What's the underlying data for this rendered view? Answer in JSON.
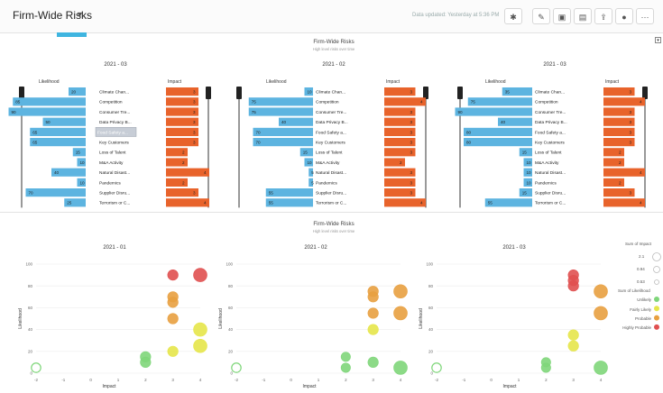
{
  "header": {
    "title": "Firm-Wide Risks",
    "updated": "Data updated: Yesterday at 5:36 PM"
  },
  "top_section": {
    "title": "Firm-Wide Risks",
    "subtitle": "High level risks over time",
    "likelihood_label": "Likelihood",
    "impact_label": "Impact",
    "panels": [
      {
        "period": "2021 - 03"
      },
      {
        "period": "2021 - 02"
      },
      {
        "period": "2021 - 03"
      }
    ],
    "tooltip": "Food Safety a..."
  },
  "bottom_section": {
    "title": "Firm-Wide Risks",
    "subtitle": "High level risks over time",
    "panels": [
      {
        "period": "2021 - 01"
      },
      {
        "period": "2021 - 02"
      },
      {
        "period": "2021 - 03"
      }
    ],
    "x_label": "Impact",
    "y_label": "Likelihood"
  },
  "legend": {
    "size_title": "Sum of Impact",
    "size_items": [
      "2.1",
      "0.94",
      "0.53"
    ],
    "color_title": "Sum of Likelihood",
    "color_items": [
      {
        "label": "Unlikely",
        "color": "#7fd67a"
      },
      {
        "label": "Fairly Likely",
        "color": "#e6e64a"
      },
      {
        "label": "Probable",
        "color": "#e8a040"
      },
      {
        "label": "Highly Probable",
        "color": "#e05050"
      }
    ]
  },
  "chart_data": [
    {
      "type": "bar",
      "title": "2021 - 03",
      "categories": [
        "Climate Chan...",
        "Competition",
        "Consumer Tre...",
        "Data Privacy B...",
        "Food Safety a...",
        "Key Customers",
        "Loss of Talent",
        "M&A Activity",
        "Natural Disast...",
        "Pandemics",
        "Supplier Disru...",
        "Terrorism or C..."
      ],
      "series": [
        {
          "name": "Likelihood",
          "values": [
            20,
            85,
            90,
            50,
            65,
            65,
            15,
            10,
            40,
            10,
            70,
            25
          ]
        },
        {
          "name": "Impact",
          "values": [
            3,
            3,
            3,
            3,
            3,
            3,
            2,
            2,
            4,
            2,
            3,
            4
          ]
        }
      ]
    },
    {
      "type": "bar",
      "title": "2021 - 02",
      "categories": [
        "Climate Chan...",
        "Competition",
        "Consumer Tre...",
        "Data Privacy B...",
        "Food Safety a...",
        "Key Customers",
        "Loss of Talent",
        "M&A Activity",
        "Natural Disast...",
        "Pandemics",
        "Supplier Disru...",
        "Terrorism or C..."
      ],
      "series": [
        {
          "name": "Likelihood",
          "values": [
            10,
            75,
            75,
            40,
            70,
            70,
            15,
            10,
            5,
            5,
            55,
            55
          ]
        },
        {
          "name": "Impact",
          "values": [
            3,
            4,
            3,
            3,
            3,
            3,
            3,
            2,
            3,
            3,
            3,
            4
          ]
        }
      ]
    },
    {
      "type": "bar",
      "title": "2021 - 03",
      "categories": [
        "Climate Chan...",
        "Competition",
        "Consumer Tre...",
        "Data Privacy B...",
        "Food Safety a...",
        "Key Customers",
        "Loss of Talent",
        "M&A Activity",
        "Natural Disast...",
        "Pandemics",
        "Supplier Disru...",
        "Terrorism or C..."
      ],
      "series": [
        {
          "name": "Likelihood",
          "values": [
            35,
            75,
            90,
            40,
            80,
            80,
            15,
            10,
            10,
            10,
            15,
            55
          ]
        },
        {
          "name": "Impact",
          "values": [
            3,
            4,
            3,
            3,
            3,
            3,
            2,
            2,
            4,
            2,
            3,
            4
          ]
        }
      ]
    },
    {
      "type": "scatter",
      "title": "2021 - 01",
      "xlabel": "Impact",
      "ylabel": "Likelihood",
      "xlim": [
        -2,
        4
      ],
      "ylim": [
        0,
        100
      ],
      "x_ticks": [
        "-2",
        "-1",
        "0",
        "1",
        "2",
        "3",
        "4"
      ],
      "y_ticks": [
        "0",
        "20",
        "40",
        "60",
        "80",
        "100"
      ],
      "points": [
        {
          "x": -2,
          "y": 5,
          "size": 0.53,
          "level": "Unlikely"
        },
        {
          "x": 2,
          "y": 15,
          "size": 0.94,
          "level": "Unlikely"
        },
        {
          "x": 2,
          "y": 10,
          "size": 0.94,
          "level": "Unlikely"
        },
        {
          "x": 3,
          "y": 90,
          "size": 0.94,
          "level": "Highly Probable"
        },
        {
          "x": 4,
          "y": 90,
          "size": 2.1,
          "level": "Highly Probable"
        },
        {
          "x": 3,
          "y": 70,
          "size": 0.94,
          "level": "Probable"
        },
        {
          "x": 3,
          "y": 65,
          "size": 0.94,
          "level": "Probable"
        },
        {
          "x": 3,
          "y": 50,
          "size": 0.94,
          "level": "Probable"
        },
        {
          "x": 4,
          "y": 40,
          "size": 2.1,
          "level": "Fairly Likely"
        },
        {
          "x": 4,
          "y": 25,
          "size": 2.1,
          "level": "Fairly Likely"
        },
        {
          "x": 3,
          "y": 20,
          "size": 0.94,
          "level": "Fairly Likely"
        }
      ]
    },
    {
      "type": "scatter",
      "title": "2021 - 02",
      "xlabel": "Impact",
      "ylabel": "Likelihood",
      "xlim": [
        -2,
        4
      ],
      "ylim": [
        0,
        100
      ],
      "x_ticks": [
        "-2",
        "-1",
        "0",
        "1",
        "2",
        "3",
        "4"
      ],
      "y_ticks": [
        "0",
        "20",
        "40",
        "60",
        "80",
        "100"
      ],
      "points": [
        {
          "x": -2,
          "y": 5,
          "size": 0.53,
          "level": "Unlikely"
        },
        {
          "x": 2,
          "y": 15,
          "size": 0.53,
          "level": "Unlikely"
        },
        {
          "x": 2,
          "y": 5,
          "size": 0.53,
          "level": "Unlikely"
        },
        {
          "x": 3,
          "y": 10,
          "size": 0.94,
          "level": "Unlikely"
        },
        {
          "x": 4,
          "y": 5,
          "size": 2.1,
          "level": "Unlikely"
        },
        {
          "x": 3,
          "y": 75,
          "size": 0.94,
          "level": "Probable"
        },
        {
          "x": 3,
          "y": 70,
          "size": 0.94,
          "level": "Probable"
        },
        {
          "x": 4,
          "y": 75,
          "size": 2.1,
          "level": "Probable"
        },
        {
          "x": 3,
          "y": 55,
          "size": 0.94,
          "level": "Probable"
        },
        {
          "x": 4,
          "y": 55,
          "size": 2.1,
          "level": "Probable"
        },
        {
          "x": 3,
          "y": 40,
          "size": 0.94,
          "level": "Fairly Likely"
        }
      ]
    },
    {
      "type": "scatter",
      "title": "2021 - 03",
      "xlabel": "Impact",
      "ylabel": "Likelihood",
      "xlim": [
        -2,
        4
      ],
      "ylim": [
        0,
        100
      ],
      "x_ticks": [
        "-2",
        "-1",
        "0",
        "1",
        "2",
        "3",
        "4"
      ],
      "y_ticks": [
        "0",
        "20",
        "40",
        "60",
        "80",
        "100"
      ],
      "points": [
        {
          "x": -2,
          "y": 5,
          "size": 0.53,
          "level": "Unlikely"
        },
        {
          "x": 2,
          "y": 10,
          "size": 0.53,
          "level": "Unlikely"
        },
        {
          "x": 2,
          "y": 5,
          "size": 0.53,
          "level": "Unlikely"
        },
        {
          "x": 3,
          "y": 90,
          "size": 0.94,
          "level": "Highly Probable"
        },
        {
          "x": 3,
          "y": 85,
          "size": 0.94,
          "level": "Highly Probable"
        },
        {
          "x": 3,
          "y": 80,
          "size": 0.94,
          "level": "Highly Probable"
        },
        {
          "x": 4,
          "y": 75,
          "size": 2.1,
          "level": "Probable"
        },
        {
          "x": 4,
          "y": 55,
          "size": 2.1,
          "level": "Probable"
        },
        {
          "x": 3,
          "y": 35,
          "size": 0.94,
          "level": "Fairly Likely"
        },
        {
          "x": 3,
          "y": 25,
          "size": 0.94,
          "level": "Fairly Likely"
        },
        {
          "x": 4,
          "y": 5,
          "size": 2.1,
          "level": "Unlikely"
        }
      ]
    }
  ]
}
